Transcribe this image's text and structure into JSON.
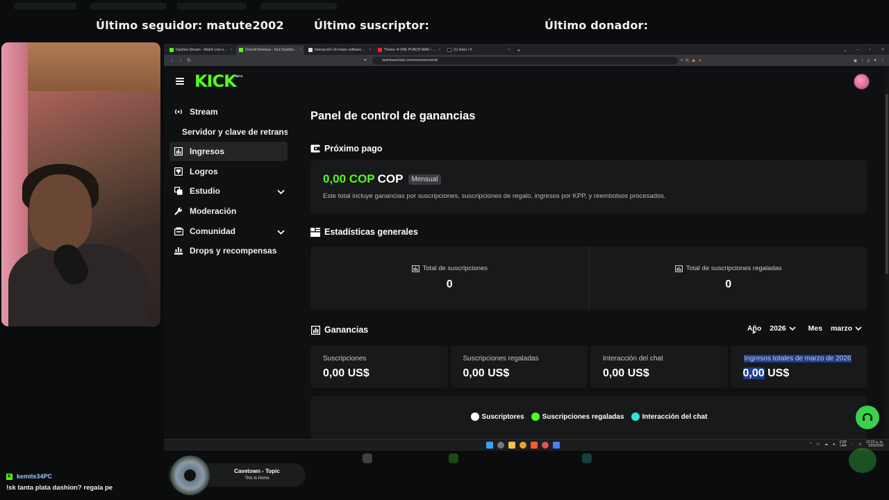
{
  "overlay": {
    "last_follower": "Último seguidor: matute2002",
    "last_subscriber": "Último suscriptor:",
    "last_donor": "Último donador:"
  },
  "browser": {
    "tabs": [
      {
        "label": "Dashion Stream - Watch Live on Kick",
        "color": "#53fc18",
        "active": false
      },
      {
        "label": "Overall Revenue - Kick Dashboard",
        "color": "#53fc18",
        "active": true
      },
      {
        "label": "Interacción | El mejor software para...",
        "color": "#dddddd",
        "active": false
      },
      {
        "label": "Theme of ONE PUNCH MAN ~Seigi",
        "color": "#ff2020",
        "active": false
      },
      {
        "label": "(1) Inicio / X",
        "color": "#111111",
        "active": false
      }
    ],
    "url": "dashboard.kick.com/revenue/overall"
  },
  "kick": {
    "logo": "KICK",
    "beta": "BETA",
    "sidebar": [
      {
        "label": "Stream",
        "icon": "broadcast-icon",
        "active": false,
        "sub": false,
        "chevron": false
      },
      {
        "label": "Servidor y clave de retransmisión",
        "icon": "",
        "active": false,
        "sub": true,
        "chevron": false
      },
      {
        "label": "Ingresos",
        "icon": "bar-chart-icon",
        "active": true,
        "sub": false,
        "chevron": false
      },
      {
        "label": "Logros",
        "icon": "trophy-icon",
        "active": false,
        "sub": false,
        "chevron": false
      },
      {
        "label": "Estudio",
        "icon": "layers-icon",
        "active": false,
        "sub": false,
        "chevron": true
      },
      {
        "label": "Moderación",
        "icon": "wrench-icon",
        "active": false,
        "sub": false,
        "chevron": false
      },
      {
        "label": "Comunidad",
        "icon": "users-icon",
        "active": false,
        "sub": false,
        "chevron": true
      },
      {
        "label": "Drops y recompensas",
        "icon": "drops-icon",
        "active": false,
        "sub": false,
        "chevron": false
      }
    ],
    "page_title": "Panel de control de ganancias",
    "next_payment": {
      "title": "Próximo pago",
      "amount": "0,00 COP",
      "currency": "COP",
      "badge": "Mensual",
      "description": "Este total incluye ganancias por suscripciones, suscripciones de regalo, ingresos por KPP, y reembolsos procesados."
    },
    "general_stats": {
      "title": "Estadísticas generales",
      "items": [
        {
          "label": "Total de suscripciones",
          "value": "0"
        },
        {
          "label": "Total de suscripciones regaladas",
          "value": "0"
        }
      ]
    },
    "earnings": {
      "title": "Ganancias",
      "year_label": "Año",
      "year_value": "2026",
      "month_label": "Mes",
      "month_value": "marzo",
      "cells": [
        {
          "label": "Suscripciones",
          "value": "0,00 US$"
        },
        {
          "label": "Suscripciones regaladas",
          "value": "0,00 US$"
        },
        {
          "label": "Interacción del chat",
          "value": "0,00 US$"
        },
        {
          "label": "Ingresos totales de marzo de 2026",
          "value_selected": "0,00",
          "value_rest": " US$"
        }
      ],
      "legend": [
        {
          "label": "Suscriptores",
          "color": "#ffffff"
        },
        {
          "label": "Suscripciones regaladas",
          "color": "#53fc18"
        },
        {
          "label": "Interacción del chat",
          "color": "#2ee6d6"
        }
      ]
    }
  },
  "taskbar": {
    "lang": "ESP",
    "lang_sub": "LAA",
    "time": "12:22 a. m.",
    "date": "1/03/2026"
  },
  "chat": {
    "username": "kemite34PC",
    "message": "!sk tanta plata dashion? regala pe"
  },
  "music": {
    "title": "Cavetown - Topic",
    "subtitle": "This Is Home"
  }
}
